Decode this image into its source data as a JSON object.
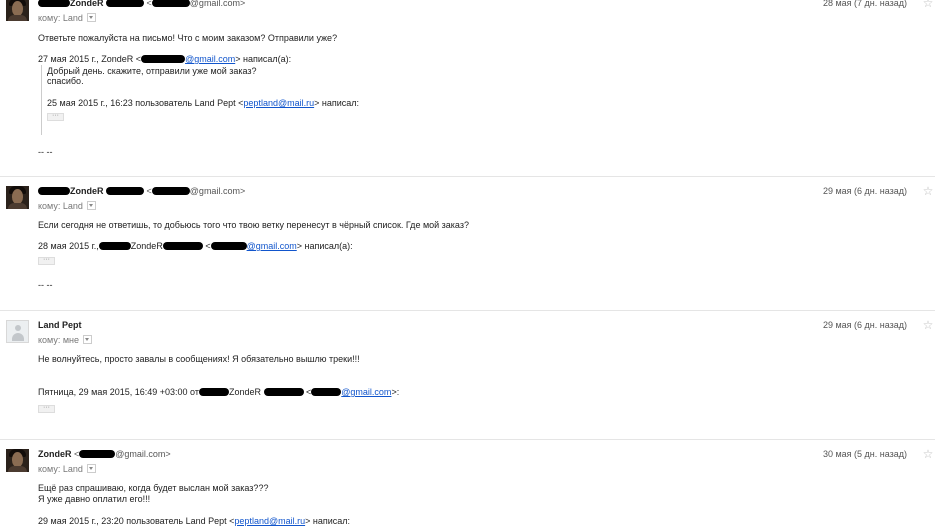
{
  "messages": [
    {
      "sender_name": "ZondeR",
      "email_suffix": "@gmail.com>",
      "to_prefix": "кому:",
      "to_value": "Land",
      "date": "28 мая (7 дн. назад)",
      "body": "Ответьте пожалуйста на письмо! Что с моим заказом? Отправили уже?",
      "quote_header_prefix": "27 мая 2015 г., ZondeR <",
      "quote_header_email": "@gmail.com",
      "quote_header_suffix": "> написал(а):",
      "quoted_lines": [
        "Добрый день. скажите, отправили уже мой заказ?",
        "спасибо."
      ],
      "nested_quote_prefix": "25 мая 2015 г., 16:23 пользователь Land Pept <",
      "nested_quote_email": "peptland@mail.ru",
      "nested_quote_suffix": "> написал:",
      "signature": "--          --"
    },
    {
      "sender_name": "ZondeR",
      "email_suffix": "@gmail.com>",
      "to_prefix": "кому:",
      "to_value": "Land",
      "date": "29 мая (6 дн. назад)",
      "body": "Если сегодня не ответишь, то добьюсь того что твою ветку перенесут в чёрный список. Где мой заказ?",
      "quote_header_prefix": "28 мая 2015 г.,",
      "quote_header_name": "ZondeR",
      "quote_header_email": "@gmail.com",
      "quote_header_suffix": "> написал(а):",
      "signature": "--          --"
    },
    {
      "sender_name": "Land Pept",
      "to_prefix": "кому:",
      "to_value": "мне",
      "date": "29 мая (6 дн. назад)",
      "body": "Не волнуйтесь, просто завалы в сообщениях! Я обязательно вышлю треки!!!",
      "quote_header_prefix": "Пятница, 29 мая 2015, 16:49 +03:00 от",
      "quote_header_name": "ZondeR",
      "quote_header_email": "@gmail.com",
      "quote_header_suffix": ">:"
    },
    {
      "sender_name": "ZondeR",
      "email_prefix": "<",
      "email_suffix": "@gmail.com>",
      "to_prefix": "кому:",
      "to_value": "Land",
      "date": "30 мая (5 дн. назад)",
      "body_lines": [
        "Ещё раз спрашиваю, когда будет выслан мой заказ???",
        "Я уже давно оплатил его!!!"
      ],
      "quote_header_prefix": "29 мая 2015 г., 23:20 пользователь Land Pept <",
      "quote_header_email": "peptland@mail.ru",
      "quote_header_suffix": "> написал:"
    }
  ],
  "icons": {
    "star": "star-icon",
    "dropdown": "chevron-down-icon",
    "ellipsis": "show-trimmed-content-icon"
  },
  "ellipsis_label": "···",
  "star_glyph": "☆",
  "colors": {
    "link": "#1155cc",
    "separator": "#e5e5e5",
    "secondary_text": "#777777"
  }
}
